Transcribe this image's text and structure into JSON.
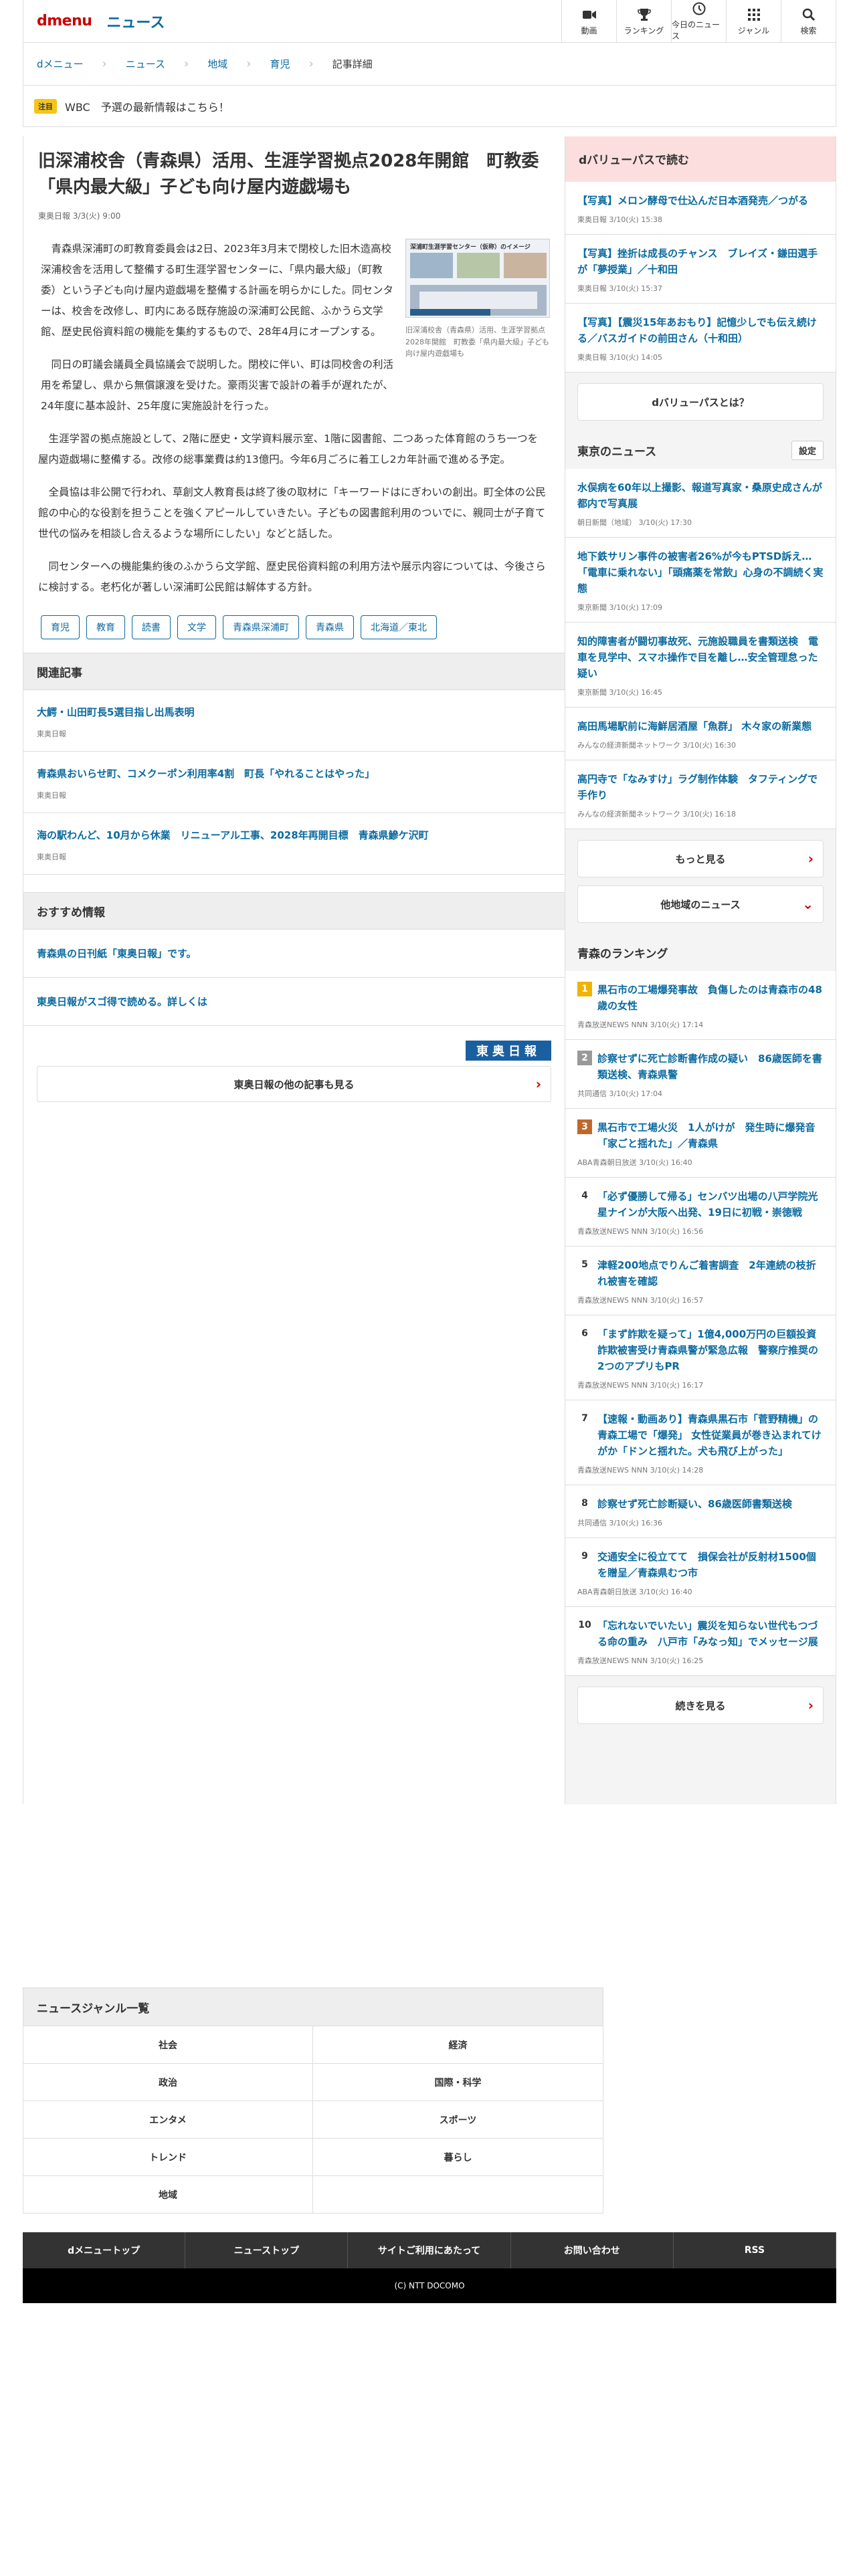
{
  "header": {
    "logo": "dmenu",
    "section": "ニュース",
    "nav": [
      {
        "label": "動画",
        "icon": "video-icon"
      },
      {
        "label": "ランキング",
        "icon": "trophy-icon"
      },
      {
        "label": "今日のニュース",
        "icon": "clock-icon"
      },
      {
        "label": "ジャンル",
        "icon": "grid-icon"
      },
      {
        "label": "検索",
        "icon": "search-icon"
      }
    ]
  },
  "breadcrumb": [
    "dメニュー",
    "ニュース",
    "地域",
    "育児",
    "記事詳細"
  ],
  "notice": {
    "badge": "注目",
    "text": "WBC　予選の最新情報はこちら！"
  },
  "article": {
    "title": "旧深浦校舎（青森県）活用、生涯学習拠点2028年開館　町教委「県内最大級」子ども向け屋内遊戯場も",
    "meta": "東奥日報 3/3(火) 9:00",
    "caption": "旧深浦校舎（青森県）活用、生涯学習拠点2028年開館　町教委「県内最大級」子ども向け屋内遊戯場も",
    "figure_title": "深浦町生涯学習センター（仮称）のイメージ",
    "paragraphs": [
      "青森県深浦町の町教育委員会は2日、2023年3月末で閉校した旧木造高校深浦校舎を活用して整備する町生涯学習センターに、「県内最大級」（町教委）という子ども向け屋内遊戯場を整備する計画を明らかにした。同センターは、校舎を改修し、町内にある既存施設の深浦町公民館、ふかうら文学館、歴史民俗資料館の機能を集約するもので、28年4月にオープンする。",
      "同日の町議会議員全員協議会で説明した。閉校に伴い、町は同校舎の利活用を希望し、県から無償譲渡を受けた。豪雨災害で設計の着手が遅れたが、24年度に基本設計、25年度に実施設計を行った。",
      "生涯学習の拠点施設として、2階に歴史・文学資料展示室、1階に図書館、二つあった体育館のうち一つを屋内遊戯場に整備する。改修の総事業費は約13億円。今年6月ごろに着工し2カ年計画で進める予定。",
      "全員協は非公開で行われ、草創文人教育長は終了後の取材に「キーワードはにぎわいの創出。町全体の公民館の中心的な役割を担うことを強くアピールしていきたい。子どもの図書館利用のついでに、親同士が子育て世代の悩みを相談し合えるような場所にしたい」などと話した。",
      "同センターへの機能集約後のふかうら文学館、歴史民俗資料館の利用方法や展示内容については、今後さらに検討する。老朽化が著しい深浦町公民館は解体する方針。"
    ],
    "tags": [
      "育児",
      "教育",
      "読書",
      "文学",
      "青森県深浦町",
      "青森県",
      "北海道／東北"
    ]
  },
  "related": {
    "heading": "関連記事",
    "items": [
      {
        "title": "大鰐・山田町長5選目指し出馬表明",
        "source": "東奥日報"
      },
      {
        "title": "青森県おいらせ町、コメクーポン利用率4割　町長「やれることはやった」",
        "source": "東奥日報"
      },
      {
        "title": "海の駅わんど、10月から休業　リニューアル工事、2028年再開目標　青森県鰺ケ沢町",
        "source": "東奥日報"
      }
    ]
  },
  "recommend": {
    "heading": "おすすめ情報",
    "items": [
      "青森県の日刊紙「東奥日報」です。",
      "東奥日報がスゴ得で読める。詳しくは"
    ]
  },
  "publisher_logo": "東奥日報",
  "more_from": "東奥日報の他の記事も見る",
  "dvalue": {
    "heading": "dバリューパスで読む",
    "items": [
      {
        "title": "【写真】メロン酵母で仕込んだ日本酒発売／つがる",
        "source": "東奥日報 3/10(火) 15:38"
      },
      {
        "title": "【写真】挫折は成長のチャンス　ブレイズ・鎌田選手が「夢授業」／十和田",
        "source": "東奥日報 3/10(火) 15:37"
      },
      {
        "title": "【写真】【震災15年あおもり】記憶少しでも伝え続ける／バスガイドの前田さん（十和田）",
        "source": "東奥日報 3/10(火) 14:05"
      }
    ],
    "button": "dバリューパスとは？"
  },
  "tokyo": {
    "heading": "東京のニュース",
    "setting": "設定",
    "items": [
      {
        "title": "水俣病を60年以上撮影、報道写真家・桑原史成さんが都内で写真展",
        "source": "朝日新聞（地域） 3/10(火) 17:30"
      },
      {
        "title": "地下鉄サリン事件の被害者26%が今もPTSD訴え…「電車に乗れない」「頭痛薬を常飲」心身の不調続く実態",
        "source": "東京新聞 3/10(火) 17:09"
      },
      {
        "title": "知的障害者が闘切事故死、元施設職員を書類送検　電車を見学中、スマホ操作で目を離し…安全管理怠った疑い",
        "source": "東京新聞 3/10(火) 16:45"
      },
      {
        "title": "高田馬場駅前に海鮮居酒屋「魚群」 木々家の新業態",
        "source": "みんなの経済新聞ネットワーク 3/10(火) 16:30"
      },
      {
        "title": "高円寺で「なみすけ」ラグ制作体験　タフティングで手作り",
        "source": "みんなの経済新聞ネットワーク 3/10(火) 16:18"
      }
    ],
    "more": "もっと見る",
    "other": "他地域のニュース"
  },
  "ranking": {
    "heading": "青森のランキング",
    "items": [
      {
        "rank": "1",
        "title": "黒石市の工場爆発事故　負傷したのは青森市の48歳の女性",
        "source": "青森放送NEWS NNN 3/10(火) 17:14",
        "color": "#f0b400"
      },
      {
        "rank": "2",
        "title": "診察せずに死亡診断書作成の疑い　86歳医師を書類送検、青森県警",
        "source": "共同通信 3/10(火) 17:04",
        "color": "#999999"
      },
      {
        "rank": "3",
        "title": "黒石市で工場火災　1人がけが　発生時に爆発音「家ごと揺れた」／青森県",
        "source": "ABA青森朝日放送 3/10(火) 16:40",
        "color": "#c0682c"
      },
      {
        "rank": "4",
        "title": "「必ず優勝して帰る」センバツ出場の八戸学院光星ナインが大阪へ出発、19日に初戦・崇徳戦",
        "source": "青森放送NEWS NNN 3/10(火) 16:56",
        "color": "#333333"
      },
      {
        "rank": "5",
        "title": "津軽200地点でりんご着害調査　2年連続の枝折れ被害を確認",
        "source": "青森放送NEWS NNN 3/10(火) 16:57",
        "color": "#333333"
      },
      {
        "rank": "6",
        "title": "「まず詐欺を疑って」1億4,000万円の巨額投資詐欺被害受け青森県警が緊急広報　警察庁推奨の2つのアプリもPR",
        "source": "青森放送NEWS NNN 3/10(火) 16:17",
        "color": "#333333"
      },
      {
        "rank": "7",
        "title": "【速報・動画あり】青森県黒石市「菅野精機」の青森工場で「爆発」 女性従業員が巻き込まれてけがか「ドンと揺れた。犬も飛び上がった」",
        "source": "青森放送NEWS NNN 3/10(火) 14:28",
        "color": "#333333"
      },
      {
        "rank": "8",
        "title": "診察せず死亡診断疑い、86歳医師書類送検",
        "source": "共同通信 3/10(火) 16:36",
        "color": "#333333"
      },
      {
        "rank": "9",
        "title": "交通安全に役立てて　損保会社が反射材1500個を贈呈／青森県むつ市",
        "source": "ABA青森朝日放送 3/10(火) 16:40",
        "color": "#333333"
      },
      {
        "rank": "10",
        "title": "「忘れないでいたい」震災を知らない世代もつづる命の重み　八戸市「みなっ知」でメッセージ展",
        "source": "青森放送NEWS NNN 3/10(火) 16:25",
        "color": "#333333"
      }
    ],
    "more": "続きを見る"
  },
  "genres": {
    "heading": "ニュースジャンル一覧",
    "items": [
      "社会",
      "経済",
      "政治",
      "国際・科学",
      "エンタメ",
      "スポーツ",
      "トレンド",
      "暮らし",
      "地域",
      ""
    ]
  },
  "footer": {
    "links": [
      "dメニュートップ",
      "ニューストップ",
      "サイトご利用にあたって",
      "お問い合わせ",
      "RSS"
    ],
    "copyright": "(C) NTT DOCOMO"
  },
  "colors": {
    "accent": "#0a6aa0",
    "brand": "#cc0000",
    "dvalue_bg": "#fcdede",
    "notice_badge": "#f5c518"
  }
}
